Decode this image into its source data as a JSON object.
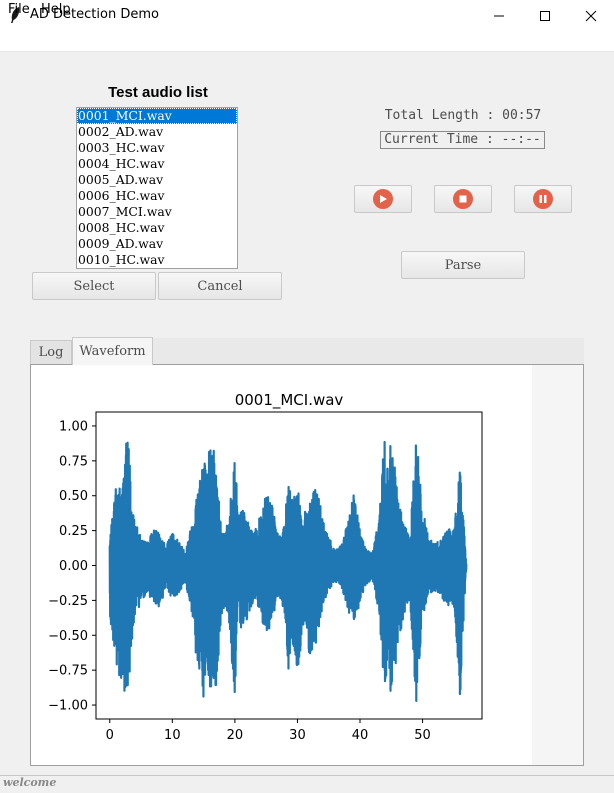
{
  "window": {
    "title": "AD Detection Demo"
  },
  "menu": {
    "items": [
      "File",
      "Help"
    ]
  },
  "audio_list": {
    "title": "Test audio list",
    "items": [
      "0001_MCI.wav",
      "0002_AD.wav",
      "0003_HC.wav",
      "0004_HC.wav",
      "0005_AD.wav",
      "0006_HC.wav",
      "0007_MCI.wav",
      "0008_HC.wav",
      "0009_AD.wav",
      "0010_HC.wav"
    ],
    "selected_index": 0
  },
  "buttons": {
    "select": "Select",
    "cancel": "Cancel",
    "parse": "Parse"
  },
  "playback": {
    "total_length": "Total Length : 00:57",
    "current_time": "Current Time : --:--",
    "icon_color": "#e0634a",
    "icons": [
      "play-icon",
      "stop-icon",
      "pause-icon"
    ]
  },
  "tabs": [
    {
      "label": "Log",
      "active": false
    },
    {
      "label": "Waveform",
      "active": true
    }
  ],
  "status": {
    "text": "welcome"
  },
  "chart_data": {
    "type": "line",
    "title": "0001_MCI.wav",
    "xlabel": "",
    "ylabel": "",
    "xlim": [
      -2.2,
      59.5
    ],
    "ylim": [
      -1.1,
      1.1
    ],
    "xticks": [
      0,
      10,
      20,
      30,
      40,
      50
    ],
    "yticks": [
      1.0,
      0.75,
      0.5,
      0.25,
      0.0,
      -0.25,
      -0.5,
      -0.75,
      -1.0
    ],
    "ytick_labels": [
      "1.00",
      "0.75",
      "0.50",
      "0.25",
      "0.00",
      "−0.25",
      "−0.50",
      "−0.75",
      "−1.00"
    ],
    "line_color": "#1f77b4",
    "grid": false,
    "series": [
      {
        "envelope_x": [
          0,
          1,
          2,
          2.5,
          3,
          3.5,
          4,
          5,
          6,
          7,
          8,
          9,
          10,
          11,
          12,
          13,
          14,
          15,
          15.5,
          16,
          16.5,
          17,
          18,
          19,
          20,
          20.5,
          21,
          22,
          23,
          24,
          25,
          26,
          27,
          28,
          28.5,
          29,
          30,
          31,
          32,
          33,
          34,
          35,
          36,
          37,
          38,
          39,
          40,
          41,
          42,
          43,
          44,
          44.5,
          45,
          46,
          47,
          48,
          49,
          50,
          51,
          52,
          53,
          54,
          55,
          56,
          57
        ],
        "envelope_upper": [
          0.18,
          0.6,
          0.55,
          0.88,
          0.95,
          0.45,
          0.32,
          0.2,
          0.16,
          0.27,
          0.22,
          0.14,
          0.24,
          0.18,
          0.1,
          0.28,
          0.55,
          0.89,
          0.6,
          0.92,
          0.92,
          0.68,
          0.25,
          0.3,
          0.86,
          0.35,
          0.44,
          0.32,
          0.22,
          0.35,
          0.58,
          0.42,
          0.2,
          0.3,
          0.69,
          0.47,
          0.55,
          0.36,
          0.49,
          0.58,
          0.35,
          0.2,
          0.12,
          0.14,
          0.3,
          0.55,
          0.25,
          0.12,
          0.09,
          0.33,
          0.98,
          0.6,
          0.96,
          0.5,
          0.3,
          0.2,
          0.95,
          0.42,
          0.19,
          0.16,
          0.19,
          0.27,
          0.25,
          0.73,
          0.01
        ],
        "envelope_lower": [
          -0.34,
          -0.75,
          -0.95,
          -0.88,
          -0.93,
          -0.55,
          -0.4,
          -0.25,
          -0.2,
          -0.26,
          -0.3,
          -0.16,
          -0.24,
          -0.2,
          -0.12,
          -0.3,
          -0.75,
          -0.99,
          -0.68,
          -0.98,
          -0.82,
          -0.9,
          -0.3,
          -0.35,
          -0.98,
          -0.32,
          -0.45,
          -0.38,
          -0.25,
          -0.34,
          -0.52,
          -0.38,
          -0.2,
          -0.35,
          -0.84,
          -0.5,
          -0.82,
          -0.4,
          -0.66,
          -0.55,
          -0.3,
          -0.18,
          -0.12,
          -0.15,
          -0.32,
          -0.4,
          -0.28,
          -0.14,
          -0.1,
          -0.35,
          -0.99,
          -0.75,
          -1.0,
          -0.6,
          -0.35,
          -0.24,
          -1.0,
          -0.38,
          -0.2,
          -0.18,
          -0.22,
          -0.3,
          -0.28,
          -0.95,
          -0.01
        ]
      }
    ]
  }
}
